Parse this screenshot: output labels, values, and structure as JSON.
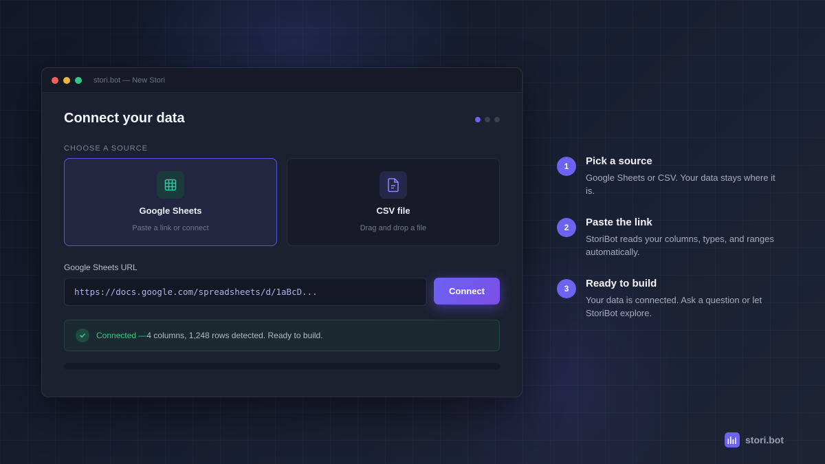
{
  "window": {
    "title": "stori.bot — New Stori"
  },
  "page": {
    "title": "Connect your data",
    "step_count": 3,
    "active_step": 1
  },
  "sources": {
    "label": "CHOOSE A SOURCE",
    "items": [
      {
        "name": "Google Sheets",
        "desc": "Paste a link or connect",
        "icon": "table-grid-icon",
        "selected": true
      },
      {
        "name": "CSV file",
        "desc": "Drag and drop a file",
        "icon": "file-icon",
        "selected": false
      }
    ]
  },
  "url_field": {
    "label": "Google Sheets URL",
    "value": "https://docs.google.com/spreadsheets/d/1aBcD..."
  },
  "connect_button": {
    "label": "Connect"
  },
  "status": {
    "ok_text": "Connected —",
    "detail": " 4 columns, 1,248 rows detected. Ready to build."
  },
  "guide": [
    {
      "num": "1",
      "title": "Pick a source",
      "desc": "Google Sheets or CSV. Your data stays where it is."
    },
    {
      "num": "2",
      "title": "Paste the link",
      "desc": "StoriBot reads your columns, types, and ranges automatically."
    },
    {
      "num": "3",
      "title": "Ready to build",
      "desc": "Your data is connected. Ask a question or let StoriBot explore."
    }
  ],
  "brand": {
    "name": "stori.bot"
  },
  "colors": {
    "accent": "#6d63f0",
    "success": "#35c98b",
    "sheets": "#34c79a",
    "csv": "#8f86f5"
  }
}
